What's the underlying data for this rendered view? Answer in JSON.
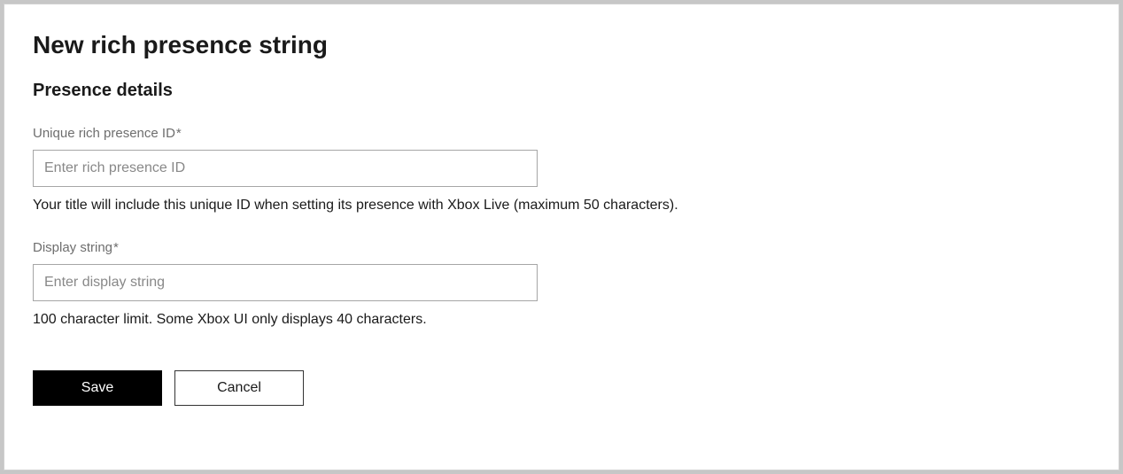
{
  "page": {
    "title": "New rich presence string",
    "section_title": "Presence details"
  },
  "fields": {
    "unique_id": {
      "label": "Unique rich presence ID",
      "required_marker": "*",
      "placeholder": "Enter rich presence ID",
      "value": "",
      "help": "Your title will include this unique ID when setting its presence with Xbox Live (maximum 50 characters)."
    },
    "display_string": {
      "label": "Display string",
      "required_marker": "*",
      "placeholder": "Enter display string",
      "value": "",
      "help": "100 character limit. Some Xbox UI only displays 40 characters."
    }
  },
  "buttons": {
    "save": "Save",
    "cancel": "Cancel"
  }
}
